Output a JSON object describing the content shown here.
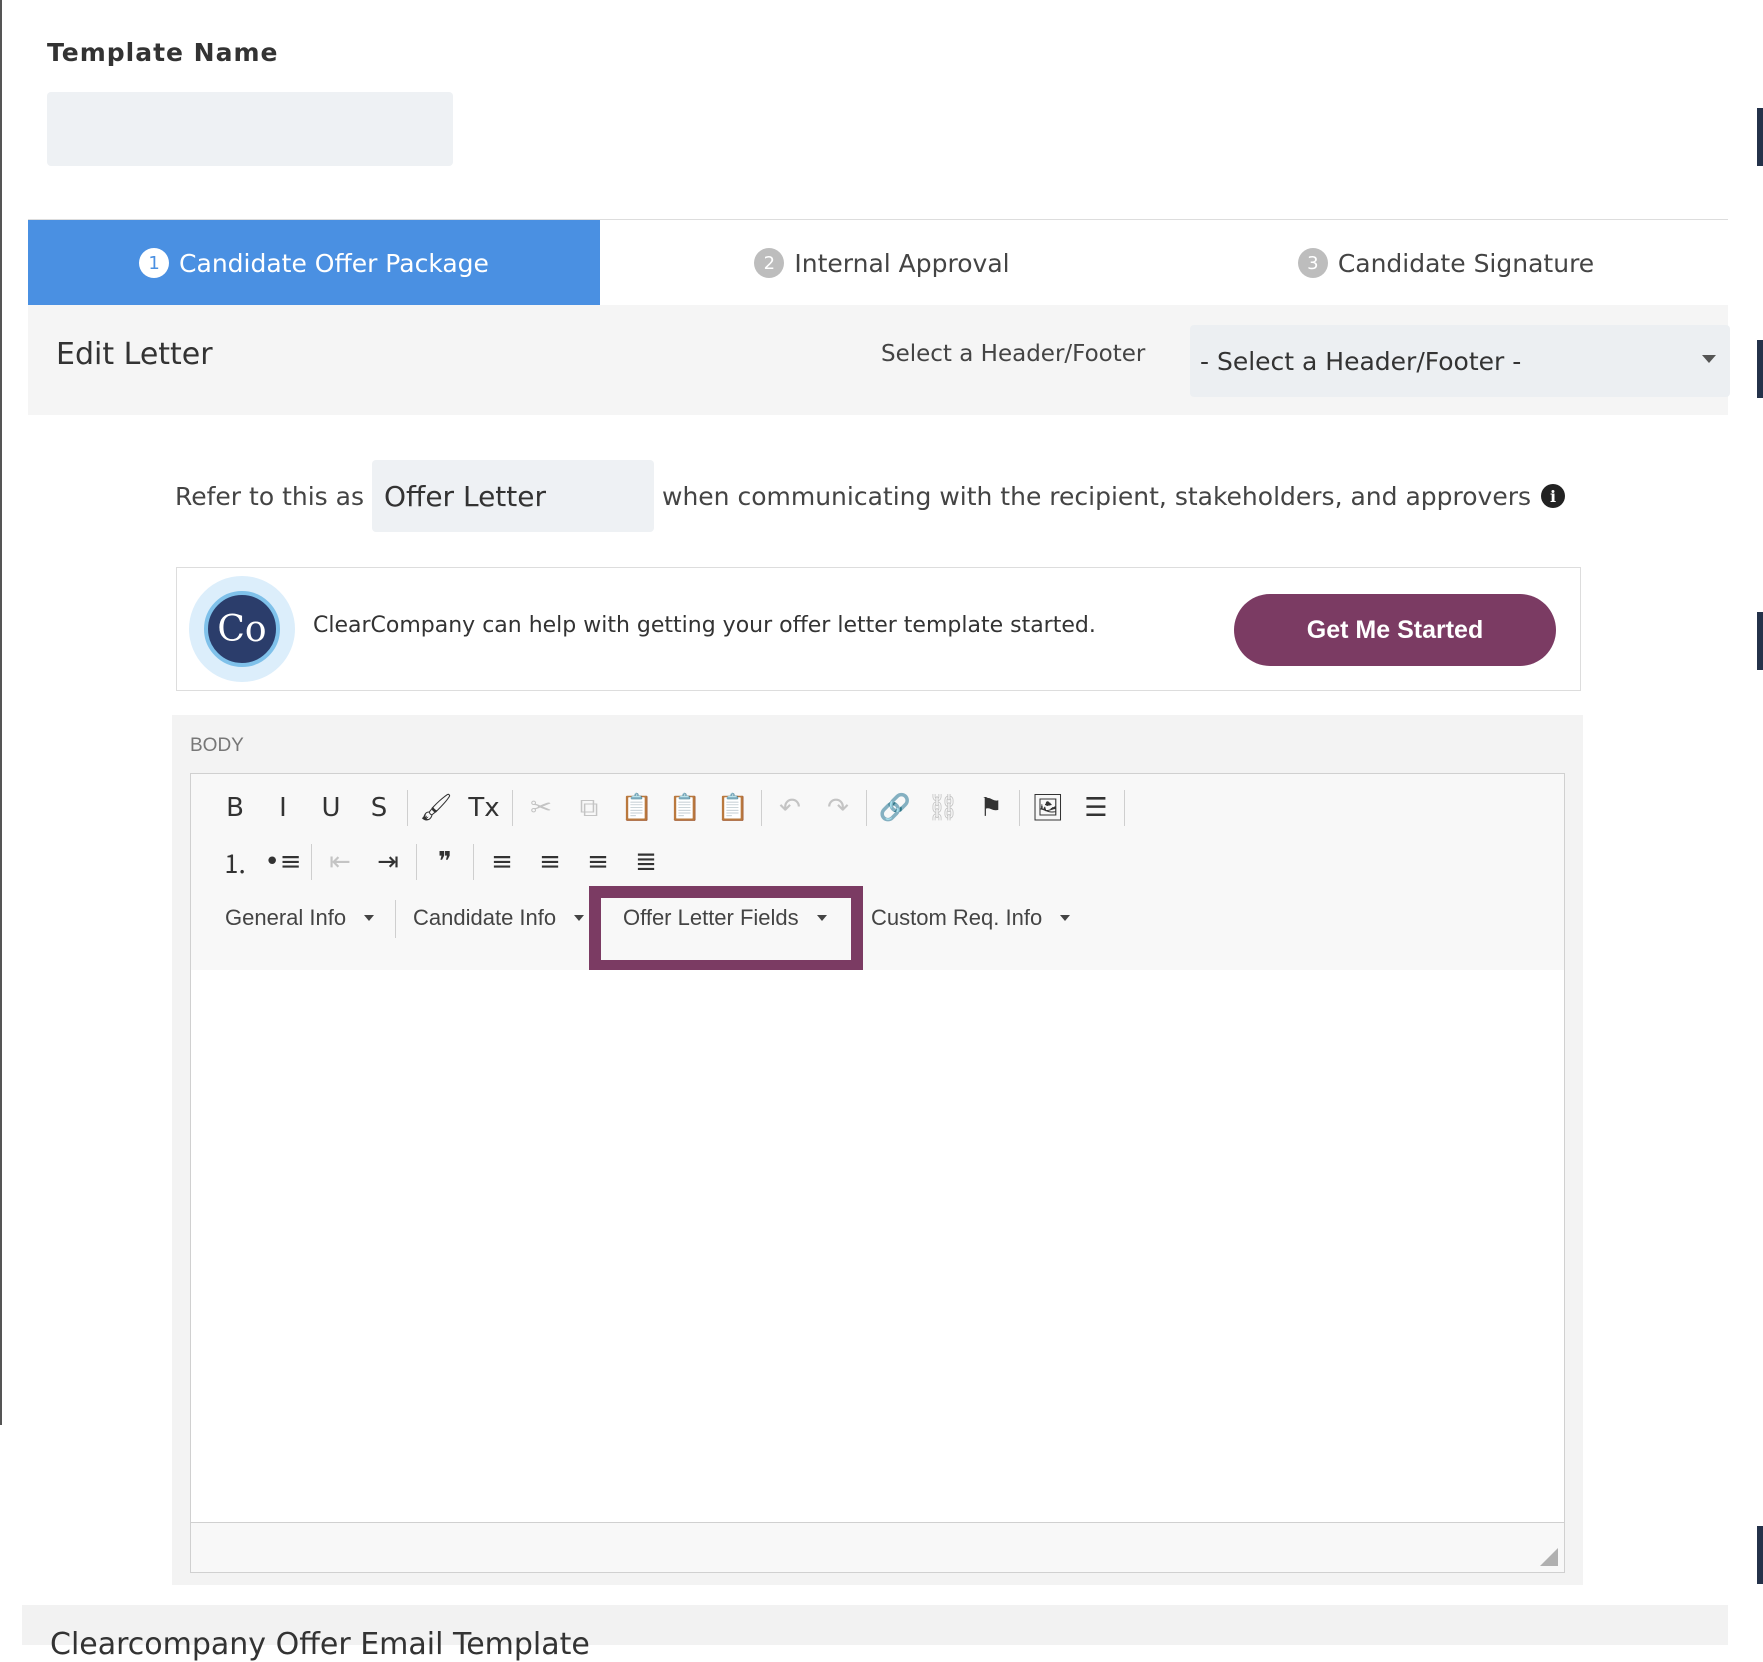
{
  "template": {
    "label": "Template Name",
    "value": ""
  },
  "tabs": [
    {
      "num": "1",
      "label": "Candidate Offer Package",
      "active": true
    },
    {
      "num": "2",
      "label": "Internal Approval",
      "active": false
    },
    {
      "num": "3",
      "label": "Candidate Signature",
      "active": false
    }
  ],
  "edit_letter": {
    "title": "Edit Letter",
    "header_footer_label": "Select a Header/Footer",
    "header_footer_value": "- Select a Header/Footer -"
  },
  "refer": {
    "prefix": "Refer to this as",
    "value": "Offer Letter",
    "suffix": "when communicating with the recipient, stakeholders, and approvers",
    "info_icon": "i"
  },
  "promo": {
    "logo_text": "Co",
    "text": "ClearCompany can help with getting your offer letter template started.",
    "button_label": "Get Me Started",
    "button_color": "#7b3b63"
  },
  "body": {
    "label": "BODY",
    "toolbar_row1": [
      {
        "name": "bold-icon",
        "glyph": "B",
        "disabled": false
      },
      {
        "name": "italic-icon",
        "glyph": "I",
        "disabled": false
      },
      {
        "name": "underline-icon",
        "glyph": "U",
        "disabled": false
      },
      {
        "name": "strikethrough-icon",
        "glyph": "S",
        "disabled": false
      },
      {
        "name": "sep"
      },
      {
        "name": "format-painter-icon",
        "glyph": "🖌",
        "disabled": false
      },
      {
        "name": "clear-formatting-icon",
        "glyph": "Tx",
        "disabled": false
      },
      {
        "name": "sep"
      },
      {
        "name": "cut-icon",
        "glyph": "✂",
        "disabled": true
      },
      {
        "name": "copy-icon",
        "glyph": "⧉",
        "disabled": true
      },
      {
        "name": "paste-icon",
        "glyph": "📋",
        "disabled": false
      },
      {
        "name": "paste-text-icon",
        "glyph": "📋",
        "disabled": false
      },
      {
        "name": "paste-word-icon",
        "glyph": "📋",
        "disabled": false
      },
      {
        "name": "sep"
      },
      {
        "name": "undo-icon",
        "glyph": "↶",
        "disabled": true
      },
      {
        "name": "redo-icon",
        "glyph": "↷",
        "disabled": true
      },
      {
        "name": "sep"
      },
      {
        "name": "link-icon",
        "glyph": "🔗",
        "disabled": false
      },
      {
        "name": "unlink-icon",
        "glyph": "⛓",
        "disabled": true
      },
      {
        "name": "anchor-flag-icon",
        "glyph": "⚑",
        "disabled": false
      },
      {
        "name": "sep"
      },
      {
        "name": "image-icon",
        "glyph": "🖼",
        "disabled": false
      },
      {
        "name": "horizontal-line-icon",
        "glyph": "☰",
        "disabled": false
      },
      {
        "name": "sep"
      }
    ],
    "toolbar_row2": [
      {
        "name": "numbered-list-icon",
        "glyph": "⒈",
        "disabled": false
      },
      {
        "name": "bulleted-list-icon",
        "glyph": "•≡",
        "disabled": false
      },
      {
        "name": "sep"
      },
      {
        "name": "decrease-indent-icon",
        "glyph": "⇤",
        "disabled": true
      },
      {
        "name": "increase-indent-icon",
        "glyph": "⇥",
        "disabled": false
      },
      {
        "name": "sep"
      },
      {
        "name": "blockquote-icon",
        "glyph": "❞",
        "disabled": false
      },
      {
        "name": "sep"
      },
      {
        "name": "align-left-icon",
        "glyph": "≡",
        "disabled": false
      },
      {
        "name": "align-center-icon",
        "glyph": "≡",
        "disabled": false
      },
      {
        "name": "align-right-icon",
        "glyph": "≡",
        "disabled": false
      },
      {
        "name": "align-justify-icon",
        "glyph": "≣",
        "disabled": false
      }
    ],
    "dropdowns": [
      "General Info",
      "Candidate Info",
      "Offer Letter Fields",
      "Custom Req. Info"
    ],
    "highlight_color": "#7b3b63"
  },
  "footer_section": {
    "title": "Clearcompany Offer Email Template"
  }
}
